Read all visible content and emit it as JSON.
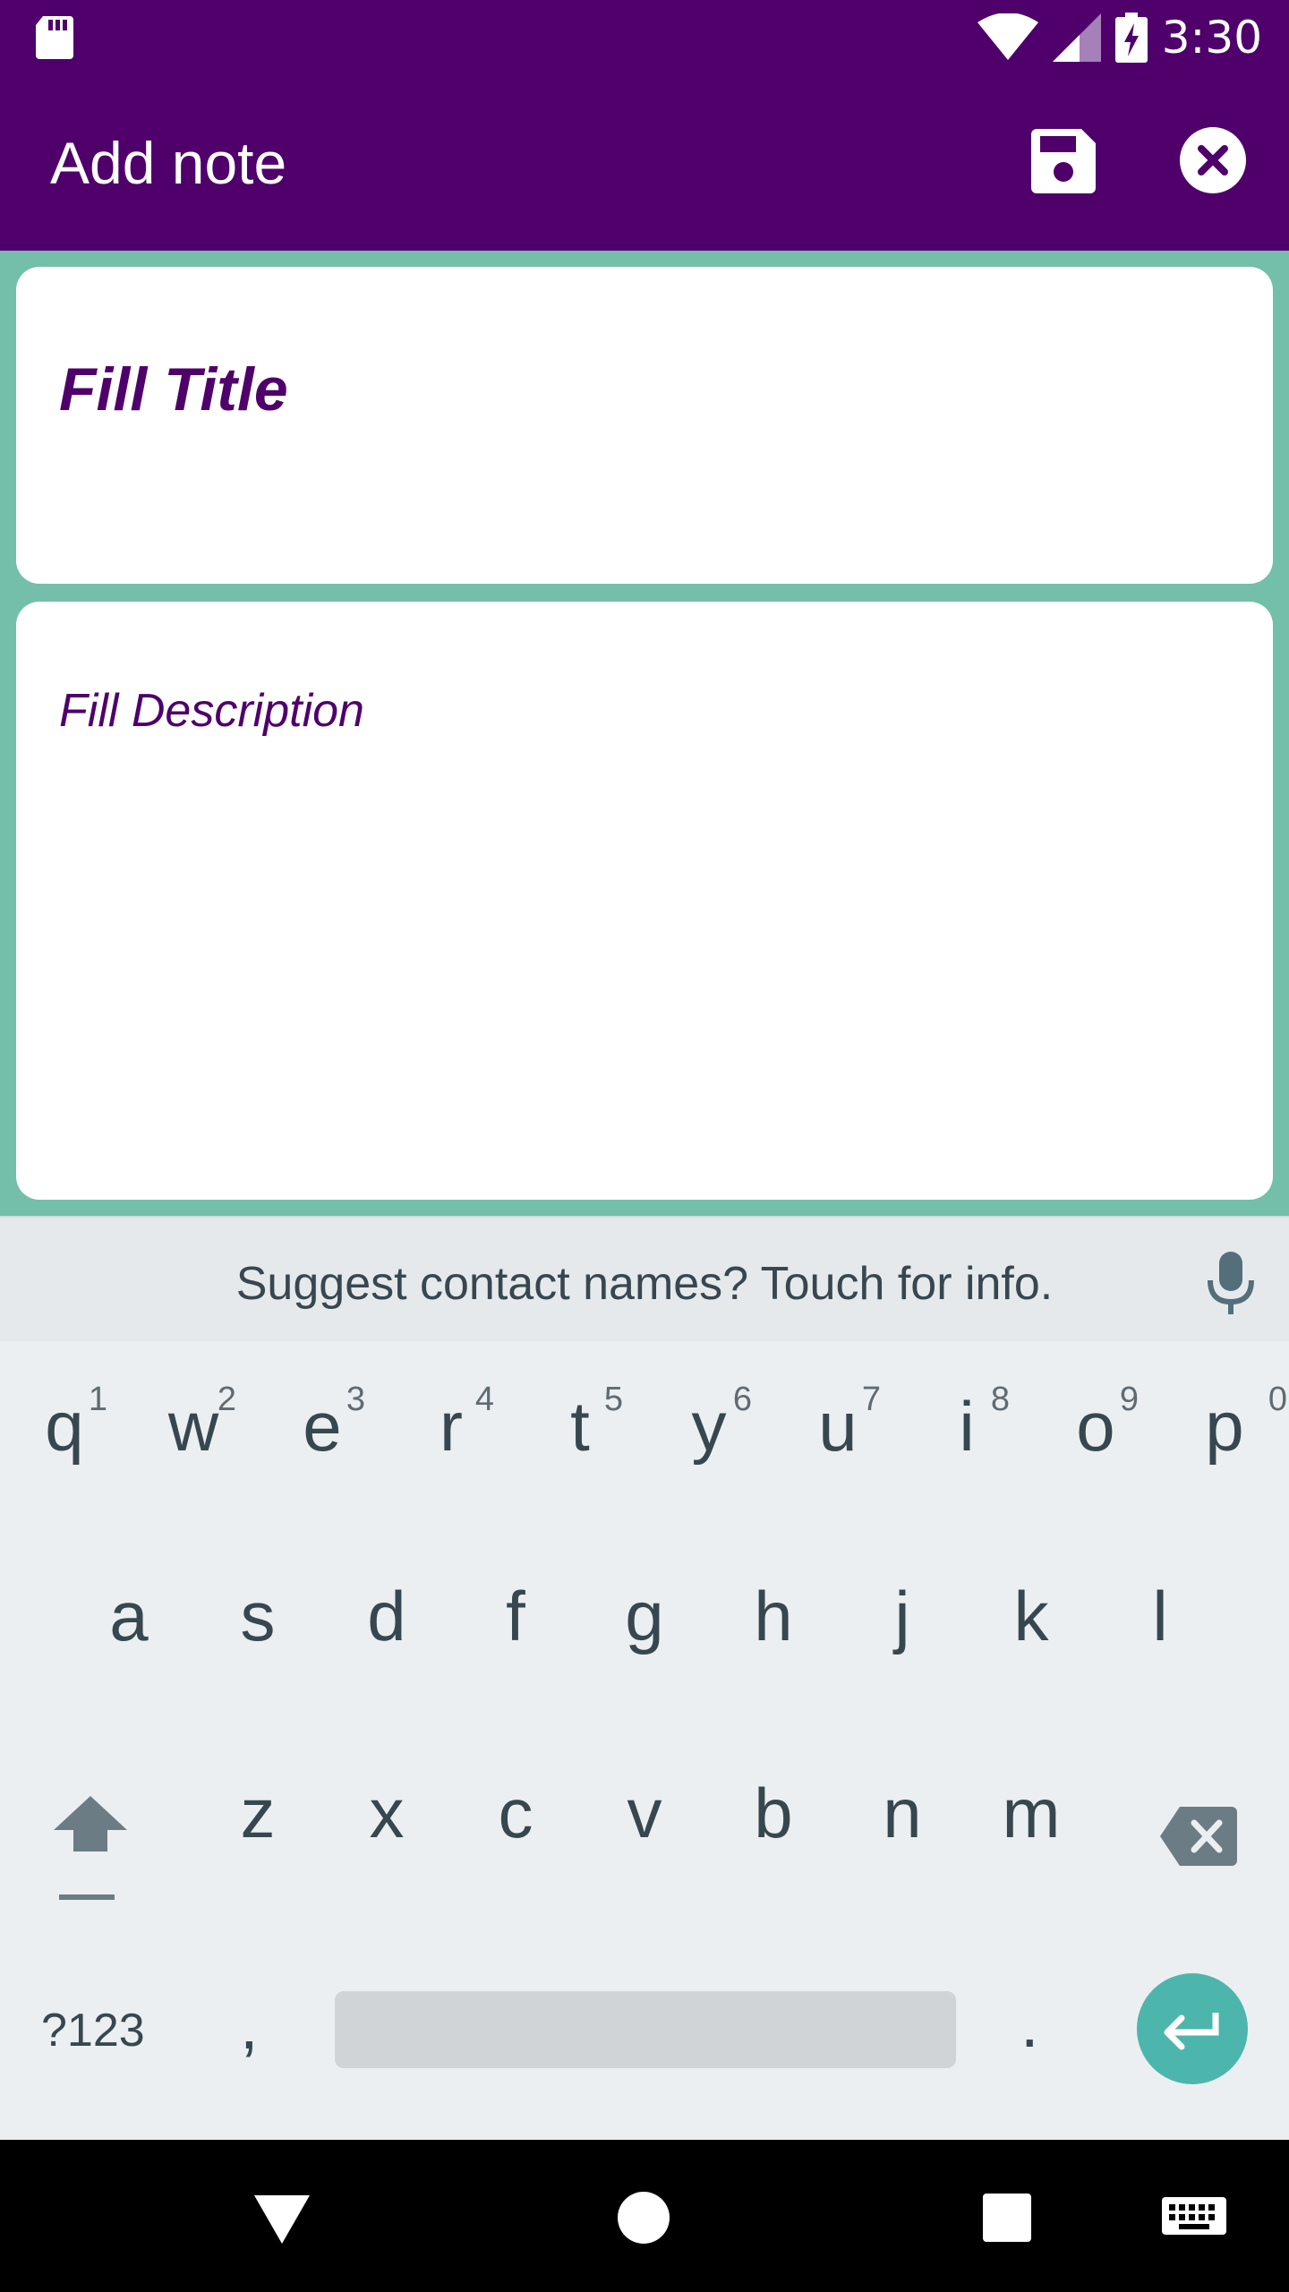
{
  "status_bar": {
    "time": "3:30",
    "icons": [
      "sd-card-icon",
      "wifi-icon",
      "signal-icon",
      "battery-charging-icon"
    ]
  },
  "app_bar": {
    "title": "Add note",
    "actions": [
      "save-icon",
      "close-icon"
    ]
  },
  "form": {
    "title_placeholder": "Fill Title",
    "description_placeholder": "Fill Description"
  },
  "colors": {
    "primary": "#4f006b",
    "background": "#74bfa9",
    "accent": "#4db6ac"
  },
  "keyboard": {
    "suggestion": "Suggest contact names? Touch for info.",
    "row1": [
      {
        "letter": "q",
        "num": "1"
      },
      {
        "letter": "w",
        "num": "2"
      },
      {
        "letter": "e",
        "num": "3"
      },
      {
        "letter": "r",
        "num": "4"
      },
      {
        "letter": "t",
        "num": "5"
      },
      {
        "letter": "y",
        "num": "6"
      },
      {
        "letter": "u",
        "num": "7"
      },
      {
        "letter": "i",
        "num": "8"
      },
      {
        "letter": "o",
        "num": "9"
      },
      {
        "letter": "p",
        "num": "0"
      }
    ],
    "row2": [
      "a",
      "s",
      "d",
      "f",
      "g",
      "h",
      "j",
      "k",
      "l"
    ],
    "row3": [
      "z",
      "x",
      "c",
      "v",
      "b",
      "n",
      "m"
    ],
    "symbols_label": "?123",
    "comma": ",",
    "period": "."
  },
  "nav_bar": {
    "icons": [
      "back-icon",
      "home-icon",
      "recents-icon",
      "keyboard-icon"
    ]
  }
}
